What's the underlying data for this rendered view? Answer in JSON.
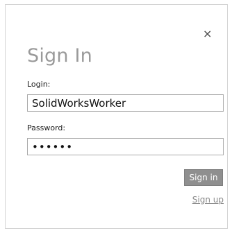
{
  "dialog": {
    "title": "Sign In",
    "close_glyph": "×",
    "close_icon": "close-icon"
  },
  "form": {
    "login_label": "Login:",
    "login_value": "SolidWorksWorker",
    "password_label": "Password:",
    "password_value": "dummyp"
  },
  "actions": {
    "signin_label": "Sign in",
    "signup_label": "Sign up"
  },
  "colors": {
    "title": "#9a9a9a",
    "button_bg": "#8f8f8f",
    "link": "#8a8a8a",
    "border": "#a9a9a9"
  }
}
